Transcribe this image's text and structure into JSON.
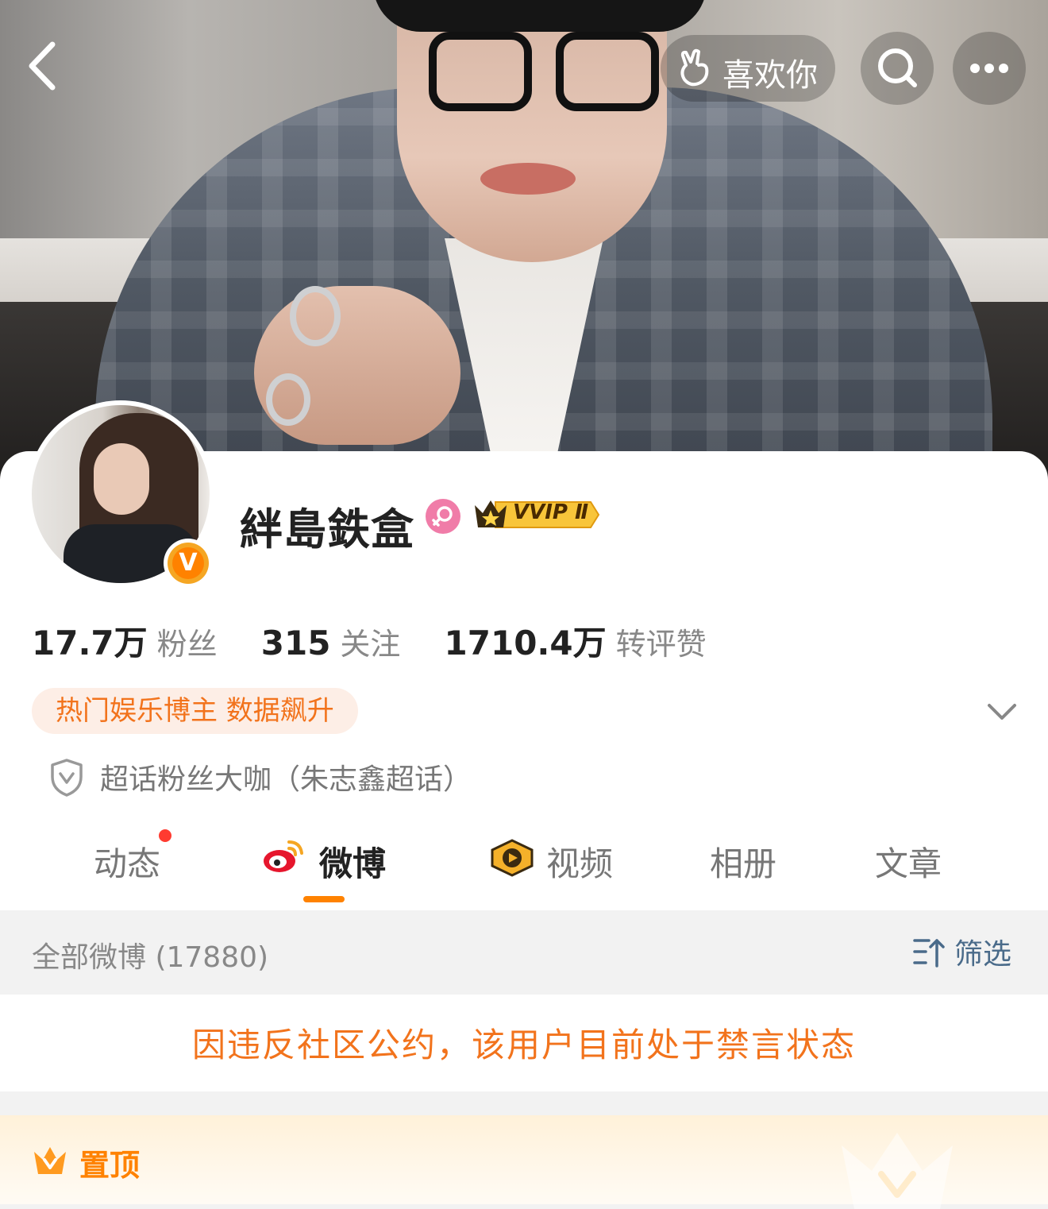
{
  "header": {
    "like_label": "喜欢你"
  },
  "profile": {
    "username": "絆島鉄盒",
    "vip_label": "VVIP Ⅱ",
    "verified_mark": "V"
  },
  "stats": [
    {
      "value": "17.7万",
      "label": "粉丝"
    },
    {
      "value": "315",
      "label": "关注"
    },
    {
      "value": "1710.4万",
      "label": "转评赞"
    }
  ],
  "tag": "热门娱乐博主 数据飙升",
  "fan_badge": "超话粉丝大咖（朱志鑫超话）",
  "tabs": [
    {
      "label": "动态",
      "has_dot": true
    },
    {
      "label": "微博",
      "active": true
    },
    {
      "label": "视频"
    },
    {
      "label": "相册"
    },
    {
      "label": "文章"
    }
  ],
  "filter_bar": {
    "count_label": "全部微博 (17880)",
    "filter_label": "筛选"
  },
  "notice": "因违反社区公约，该用户目前处于禁言状态",
  "pinned_label": "置顶",
  "colors": {
    "accent": "#ff8200",
    "tag_text": "#f2731c",
    "tag_bg": "#fdeee6",
    "filter_text": "#4a6b8a"
  },
  "icons": [
    "back-icon",
    "like-hand-icon",
    "search-icon",
    "more-icon",
    "female-icon",
    "vvip-crown-icon",
    "verified-v-icon",
    "chevron-down-icon",
    "shield-icon",
    "weibo-logo-icon",
    "video-icon",
    "filter-icon",
    "crown-icon"
  ]
}
